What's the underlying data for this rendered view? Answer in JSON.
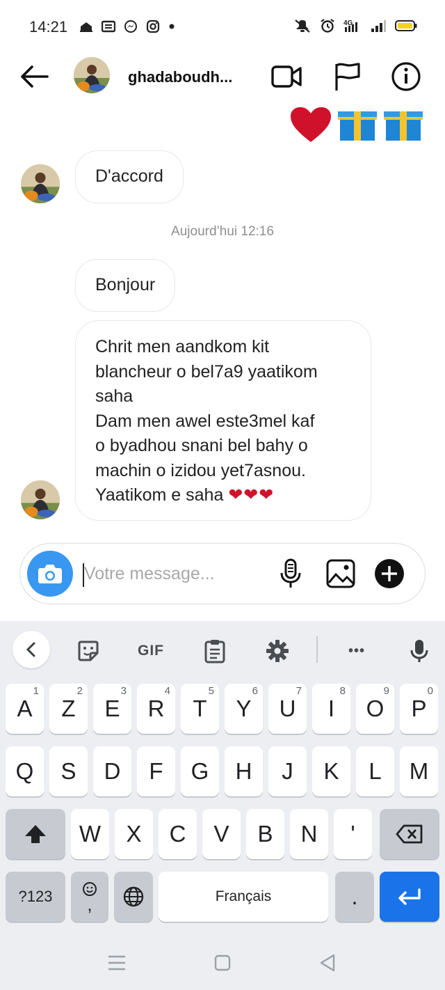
{
  "status_bar": {
    "time": "14:21",
    "left_icons": [
      "home-icon",
      "news-icon",
      "messenger-icon",
      "instagram-icon",
      "dot-icon"
    ],
    "right_icons": [
      "mute-icon",
      "alarm-icon",
      "4g-icon",
      "signal-icon",
      "battery-icon"
    ]
  },
  "header": {
    "username": "ghadaboudh...",
    "back_icon": "arrow-left-icon",
    "video_icon": "video-camera-icon",
    "flag_icon": "flag-icon",
    "info_icon": "info-icon"
  },
  "chat": {
    "top_emojis": [
      "heart",
      "gift",
      "gift"
    ],
    "messages": [
      {
        "sender": "other",
        "text": "D'accord"
      },
      {
        "sender": "other",
        "text": "Bonjour"
      },
      {
        "sender": "other",
        "lines": [
          "Chrit men aandkom kit",
          "blancheur o bel7a9 yaatikom",
          "saha",
          "Dam men awel este3mel kaf",
          "o byadhou snani bel bahy o",
          "machin o izidou yet7asnou.",
          "Yaatikom e saha"
        ],
        "hearts": "❤❤❤"
      }
    ],
    "timestamp": "Aujourd’hui 12:16"
  },
  "composer": {
    "placeholder": "Votre message..."
  },
  "keyboard": {
    "toolbar": {
      "gif": "GIF",
      "more": "•••"
    },
    "row1": [
      {
        "label": "A",
        "hint": "1"
      },
      {
        "label": "Z",
        "hint": "2"
      },
      {
        "label": "E",
        "hint": "3"
      },
      {
        "label": "R",
        "hint": "4"
      },
      {
        "label": "T",
        "hint": "5"
      },
      {
        "label": "Y",
        "hint": "6"
      },
      {
        "label": "U",
        "hint": "7"
      },
      {
        "label": "I",
        "hint": "8"
      },
      {
        "label": "O",
        "hint": "9"
      },
      {
        "label": "P",
        "hint": "0"
      }
    ],
    "row2": [
      "Q",
      "S",
      "D",
      "F",
      "G",
      "H",
      "J",
      "K",
      "L",
      "M"
    ],
    "row3": [
      "W",
      "X",
      "C",
      "V",
      "B",
      "N",
      "'"
    ],
    "symbols_label": "?123",
    "emoji_comma": ",",
    "space_label": "Français",
    "period_label": "."
  },
  "colors": {
    "accent_blue": "#3897f0",
    "enter_blue": "#1a73e8",
    "heart_red": "#d0112b"
  }
}
